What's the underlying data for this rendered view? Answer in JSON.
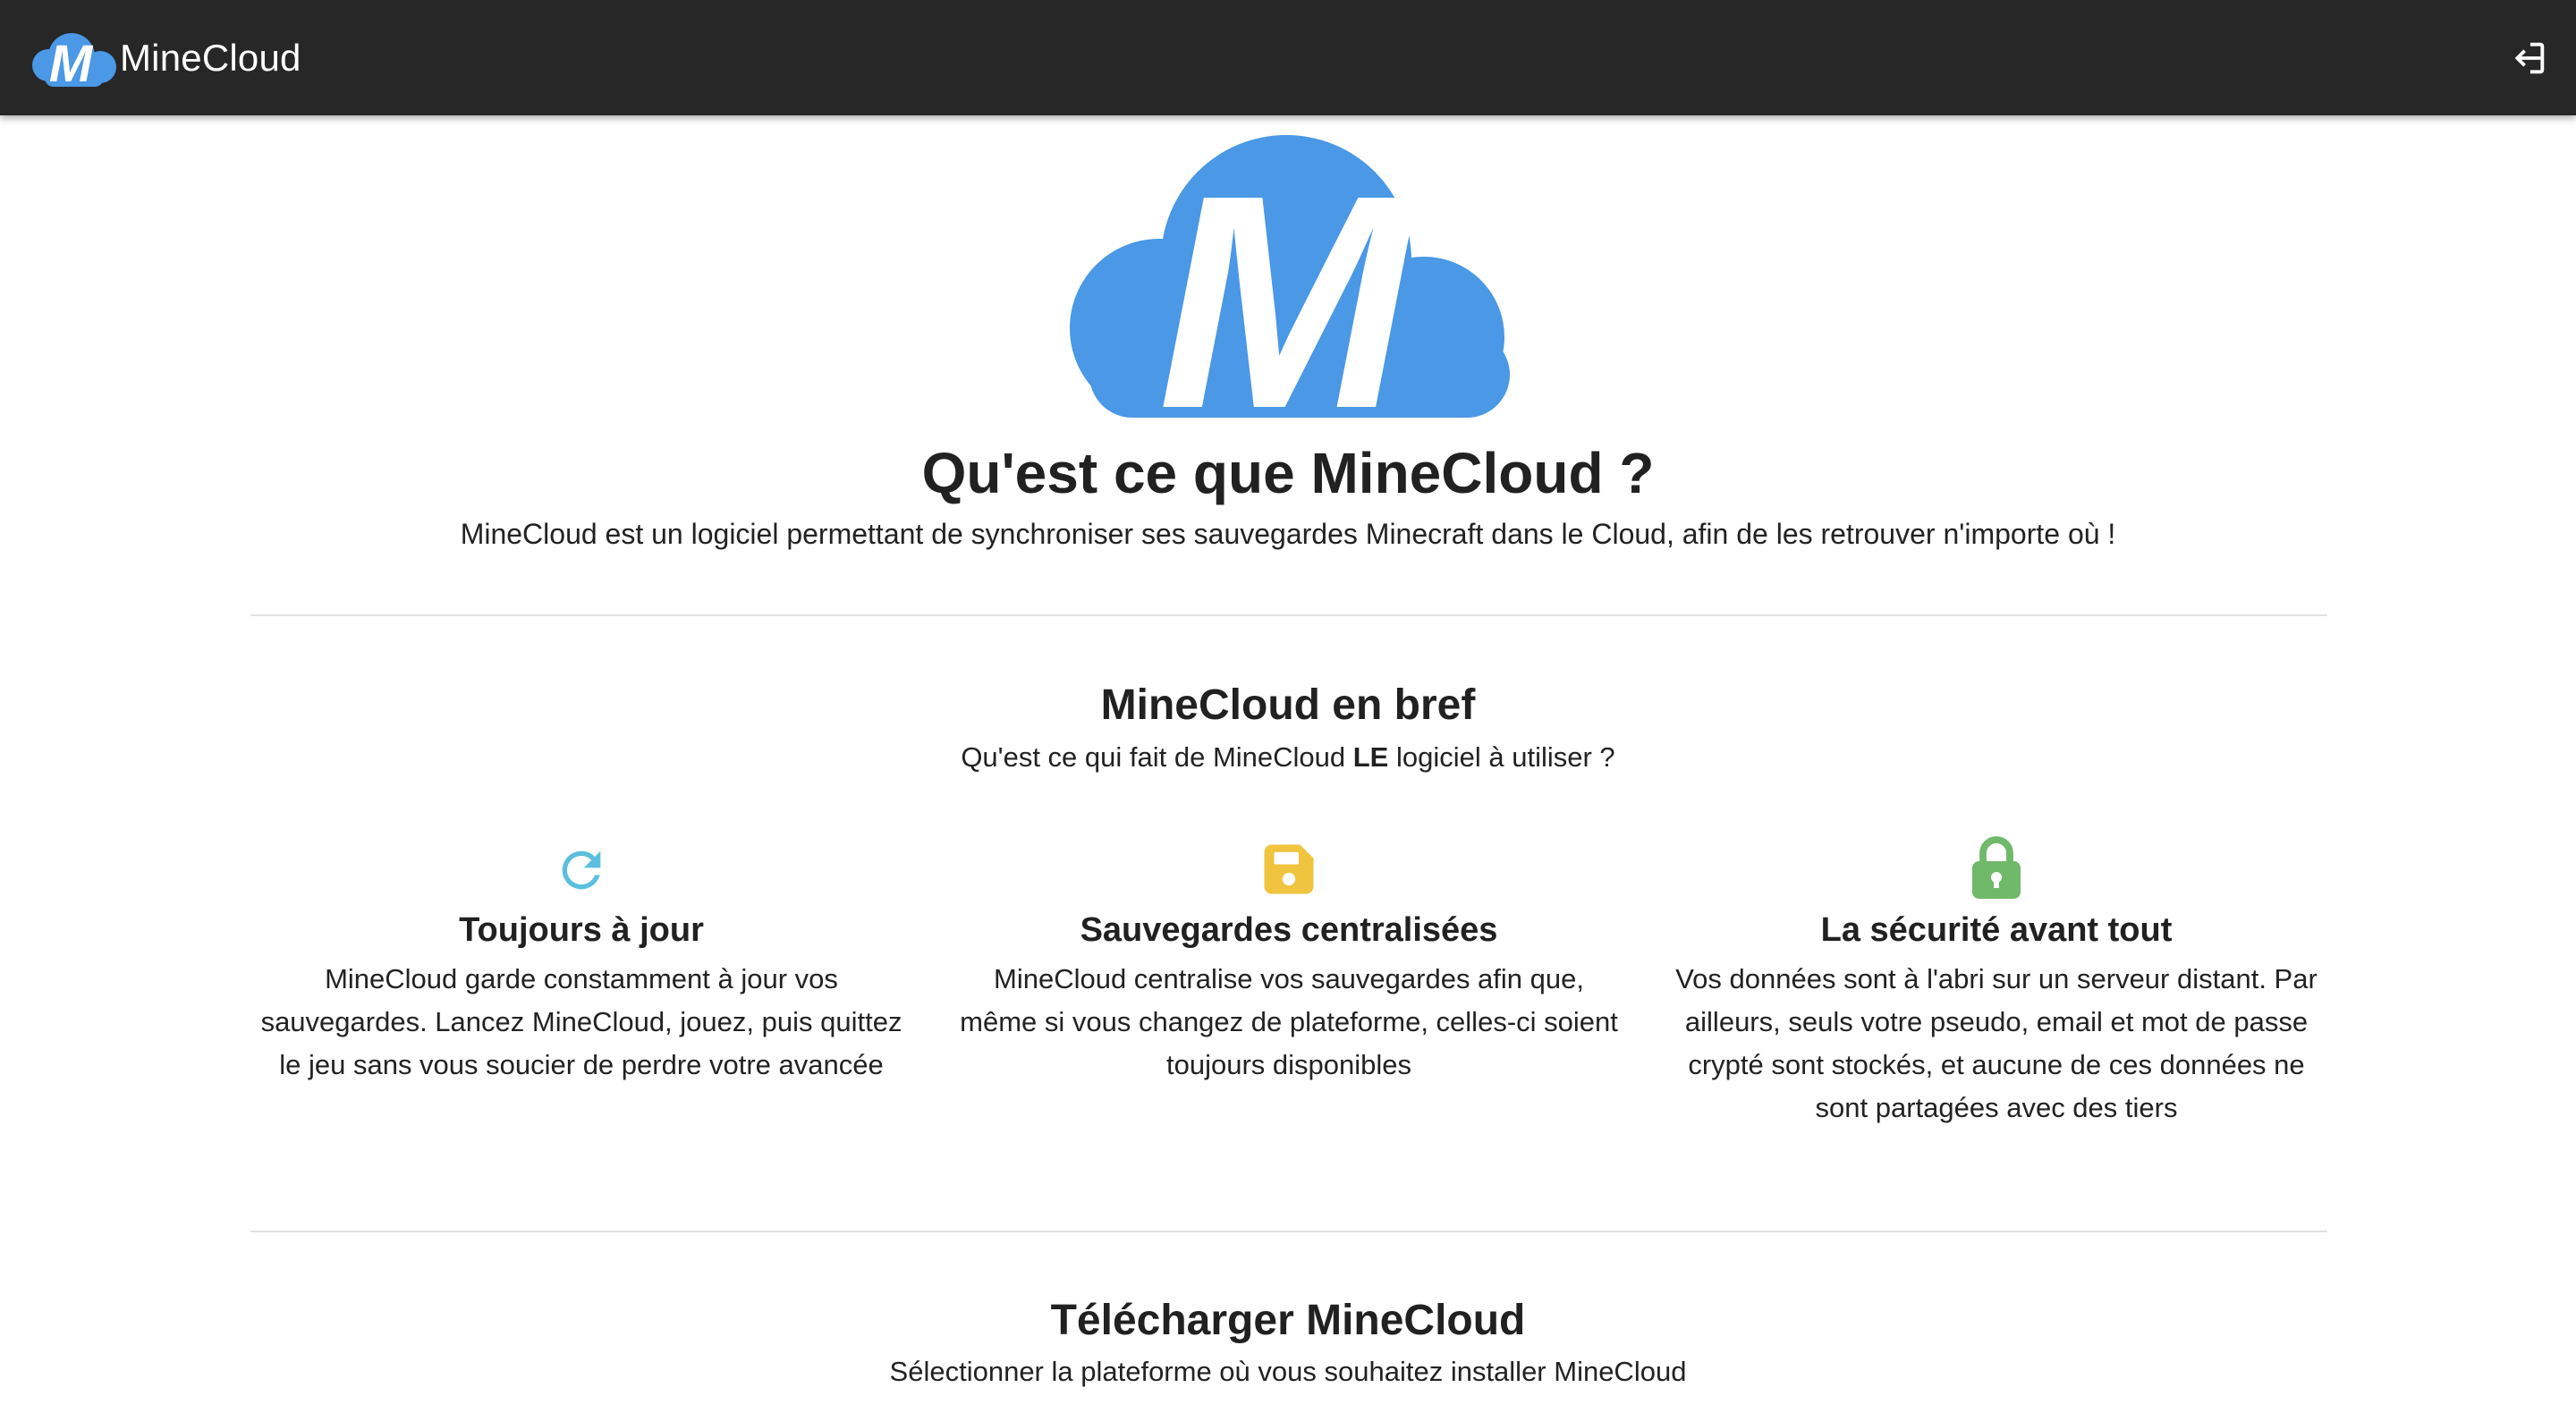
{
  "header": {
    "app_name": "MineCloud",
    "logo_letter": "M",
    "login_icon": "login-icon"
  },
  "hero": {
    "logo_letter": "M",
    "title": "Qu'est ce que MineCloud ?",
    "description": "MineCloud est un logiciel permettant de synchroniser ses sauvegardes Minecraft dans le Cloud, afin de les retrouver n'importe où !"
  },
  "brief": {
    "title": "MineCloud en bref",
    "subtitle_before": "Qu'est ce qui fait de MineCloud ",
    "subtitle_bold": "LE",
    "subtitle_after": " logiciel à utiliser ?",
    "features": [
      {
        "icon": "refresh-icon",
        "title": "Toujours à jour",
        "text": "MineCloud garde constamment à jour vos sauvegardes. Lancez MineCloud, jouez, puis quittez le jeu sans vous soucier de perdre votre avancée"
      },
      {
        "icon": "save-icon",
        "title": "Sauvegardes centralisées",
        "text": "MineCloud centralise vos sauvegardes afin que, même si vous changez de plateforme, celles-ci soient toujours disponibles"
      },
      {
        "icon": "lock-icon",
        "title": "La sécurité avant tout",
        "text": "Vos données sont à l'abri sur un serveur distant. Par ailleurs, seuls votre pseudo, email et mot de passe crypté sont stockés, et aucune de ces données ne sont partagées avec des tiers"
      }
    ]
  },
  "download": {
    "title": "Télécharger MineCloud",
    "subtitle": "Sélectionner la plateforme où vous souhaitez installer MineCloud"
  },
  "colors": {
    "topbar": "#272727",
    "brand_blue": "#4a98e6",
    "refresh_icon": "#5bc0de",
    "save_icon": "#f0c43e",
    "lock_icon": "#70b86a"
  }
}
